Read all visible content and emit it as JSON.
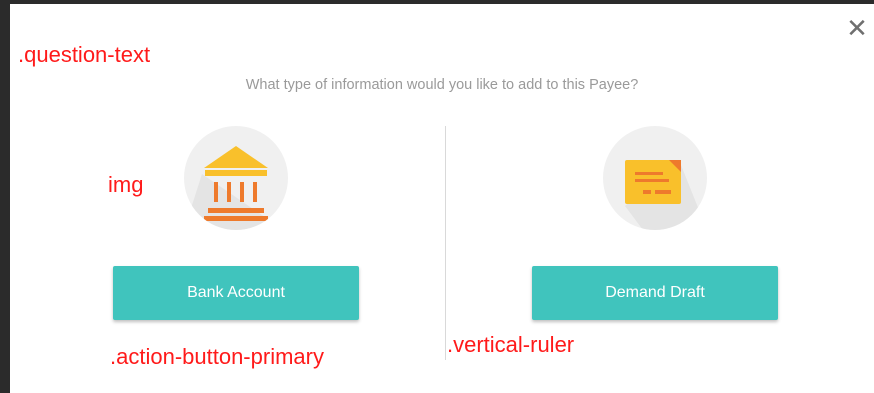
{
  "dialog": {
    "question": "What type of information would you like to add to this Payee?",
    "close_symbol": "✕"
  },
  "options": [
    {
      "label": "Bank Account",
      "icon": "bank-icon"
    },
    {
      "label": "Demand Draft",
      "icon": "demand-draft-icon"
    }
  ],
  "annotations": {
    "question_text": ".question-text",
    "img": "img",
    "action_button_primary": ".action-button-primary",
    "vertical_ruler": ".vertical-ruler"
  },
  "colors": {
    "button": "#40c4bd",
    "icon_yellow": "#f9c02b",
    "icon_orange": "#ee7a2c",
    "annotation": "#ff1a1a"
  }
}
